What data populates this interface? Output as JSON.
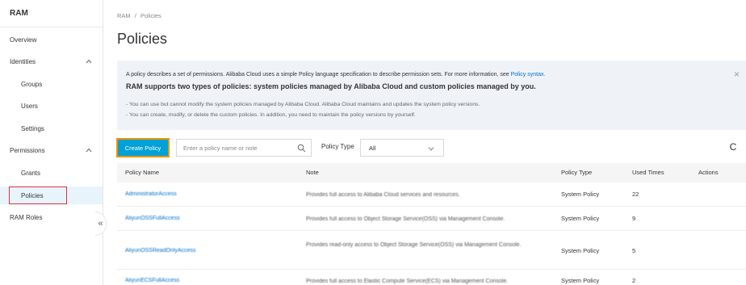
{
  "sidebar": {
    "title": "RAM",
    "items": [
      {
        "label": "Overview"
      },
      {
        "label": "Identities"
      },
      {
        "label": "Groups"
      },
      {
        "label": "Users"
      },
      {
        "label": "Settings"
      },
      {
        "label": "Permissions"
      },
      {
        "label": "Grants"
      },
      {
        "label": "Policies"
      },
      {
        "label": "RAM Roles"
      }
    ],
    "collapse_glyph": "«"
  },
  "breadcrumb": {
    "root": "RAM",
    "separator": "/",
    "current": "Policies"
  },
  "page_title": "Policies",
  "notice": {
    "intro": "A policy describes a set of permissions. Alibaba Cloud uses a simple Policy language specification to describe permission sets. For more information, see ",
    "link": "Policy syntax.",
    "headline": "RAM supports two types of policies: system policies managed by Alibaba Cloud and custom policies managed by you.",
    "line1": "- You can use but cannot modify the system policies managed by Alibaba Cloud. Alibaba Cloud maintains and updates the system policy versions.",
    "line2": "- You can create, modify, or delete the custom policies. In addition, you need to maintain the policy versions by yourself.",
    "close_glyph": "×"
  },
  "toolbar": {
    "create_label": "Create Policy",
    "search_placeholder": "Enter a policy name or note",
    "policy_type_label": "Policy Type",
    "policy_type_value": "All",
    "refresh_glyph": "C"
  },
  "table": {
    "headers": [
      "Policy Name",
      "Note",
      "Policy Type",
      "Used Times",
      "Actions"
    ],
    "rows": [
      {
        "name": "AdministratorAccess",
        "note": "Provides full access to Alibaba Cloud services and resources.",
        "type": "System Policy",
        "used": "22"
      },
      {
        "name": "AliyunOSSFullAccess",
        "note": "Provides full access to Object Storage Service(OSS) via Management Console.",
        "type": "System Policy",
        "used": "9"
      },
      {
        "name": "AliyunOSSReadOnlyAccess",
        "note": "Provides read-only access to Object Storage Service(OSS) via Management Console.",
        "type": "System Policy",
        "used": "5"
      },
      {
        "name": "AliyunECSFullAccess",
        "note": "Provides full access to Elastic Compute Service(ECS) via Management Console.",
        "type": "System Policy",
        "used": "2"
      }
    ]
  },
  "colors": {
    "accent": "#00a1d6",
    "highlight": "#e0303d",
    "link": "#0070cc"
  }
}
